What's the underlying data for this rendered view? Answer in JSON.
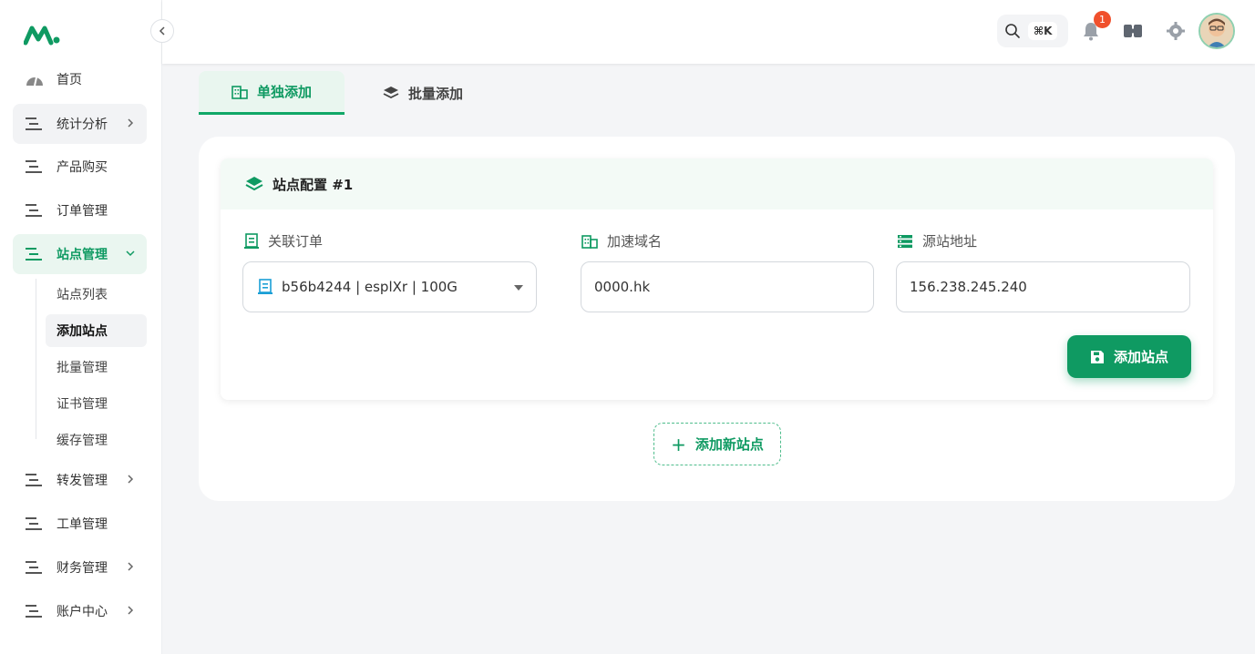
{
  "brand": {
    "accent": "#0f9a62"
  },
  "sidebar": {
    "items": [
      {
        "label": "首页",
        "icon": "dashboard-gauge-icon"
      },
      {
        "label": "统计分析",
        "icon": "menu-lines-icon",
        "expandable": true
      },
      {
        "label": "产品购买",
        "icon": "menu-lines-icon"
      },
      {
        "label": "订单管理",
        "icon": "menu-lines-icon"
      },
      {
        "label": "站点管理",
        "icon": "menu-lines-icon",
        "expanded": true,
        "active": true
      },
      {
        "label": "转发管理",
        "icon": "menu-lines-icon",
        "expandable": true
      },
      {
        "label": "工单管理",
        "icon": "menu-lines-icon"
      },
      {
        "label": "财务管理",
        "icon": "menu-lines-icon",
        "expandable": true
      },
      {
        "label": "账户中心",
        "icon": "menu-lines-icon",
        "expandable": true
      }
    ],
    "subitems": [
      {
        "label": "站点列表"
      },
      {
        "label": "添加站点",
        "active": true
      },
      {
        "label": "批量管理"
      },
      {
        "label": "证书管理"
      },
      {
        "label": "缓存管理"
      }
    ]
  },
  "header": {
    "shortcut": "⌘K",
    "notification_count": "1"
  },
  "tabs": [
    {
      "label": "单独添加",
      "active": true
    },
    {
      "label": "批量添加"
    }
  ],
  "site_config": {
    "title": "站点配置 #1",
    "order_label": "关联订单",
    "order_value": "b56b4244 | esplXr | 100G",
    "domain_label": "加速域名",
    "domain_value": "0000.hk",
    "origin_label": "源站地址",
    "origin_value": "156.238.245.240",
    "save_label": "添加站点"
  },
  "add_new_label": "添加新站点"
}
